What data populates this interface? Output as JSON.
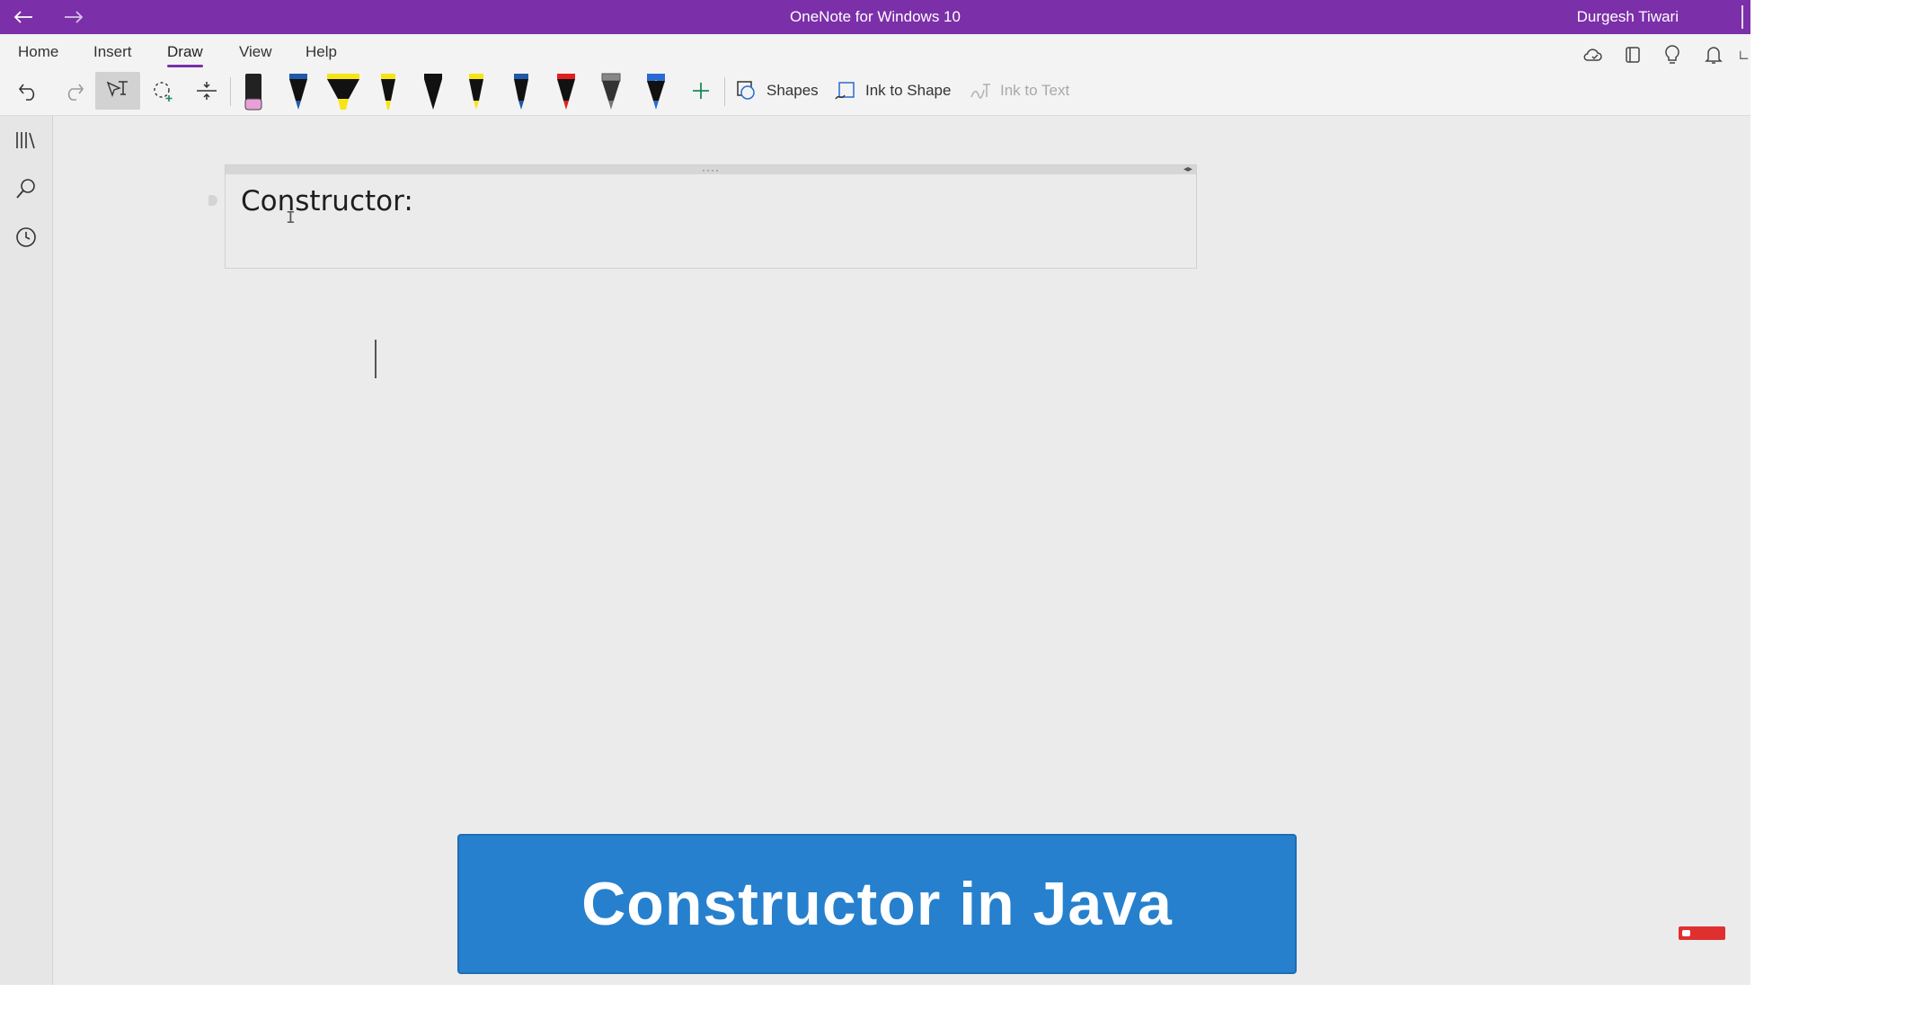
{
  "titlebar": {
    "title": "OneNote for Windows 10",
    "user": "Durgesh Tiwari",
    "back_icon": "arrow-left-icon",
    "forward_icon": "arrow-right-icon"
  },
  "ribbon": {
    "tabs": [
      {
        "label": "Home"
      },
      {
        "label": "Insert"
      },
      {
        "label": "Draw",
        "active": true
      },
      {
        "label": "View"
      },
      {
        "label": "Help"
      }
    ],
    "right_icons": [
      "sync-icon",
      "notebook-icon",
      "lightbulb-icon",
      "bell-icon",
      "expand-icon"
    ],
    "tools": [
      "undo-icon",
      "redo-icon",
      "type-select-icon",
      "lasso-select-icon",
      "insert-space-icon"
    ],
    "pens": [
      {
        "name": "pink-highlighter",
        "color": "#e8a0d8"
      },
      {
        "name": "blue-pen",
        "color": "#1e5aa8"
      },
      {
        "name": "yellow-highlighter-wide",
        "color": "#f6e416"
      },
      {
        "name": "yellow-highlighter",
        "color": "#f6e416"
      },
      {
        "name": "black-pen",
        "color": "#111111"
      },
      {
        "name": "yellow-pen",
        "color": "#f6e416"
      },
      {
        "name": "blue-pen-2",
        "color": "#1e5aa8"
      },
      {
        "name": "red-pen",
        "color": "#e02020"
      },
      {
        "name": "pencil",
        "color": "#777777"
      },
      {
        "name": "galaxy-pen",
        "color": "#2a6bd1"
      }
    ],
    "add_pen_icon": "plus-icon",
    "shapes_label": "Shapes",
    "ink_to_shape_label": "Ink to Shape",
    "ink_to_text_label": "Ink to Text"
  },
  "sidebar": {
    "icons": [
      "notebooks-icon",
      "search-icon",
      "recent-clock-icon"
    ]
  },
  "page": {
    "note_text": "Constructor:",
    "banner_text": "Constructor in Java"
  },
  "colors": {
    "titlebar": "#7b2fa8",
    "banner": "#2680cd",
    "canvas": "#ebebeb"
  }
}
